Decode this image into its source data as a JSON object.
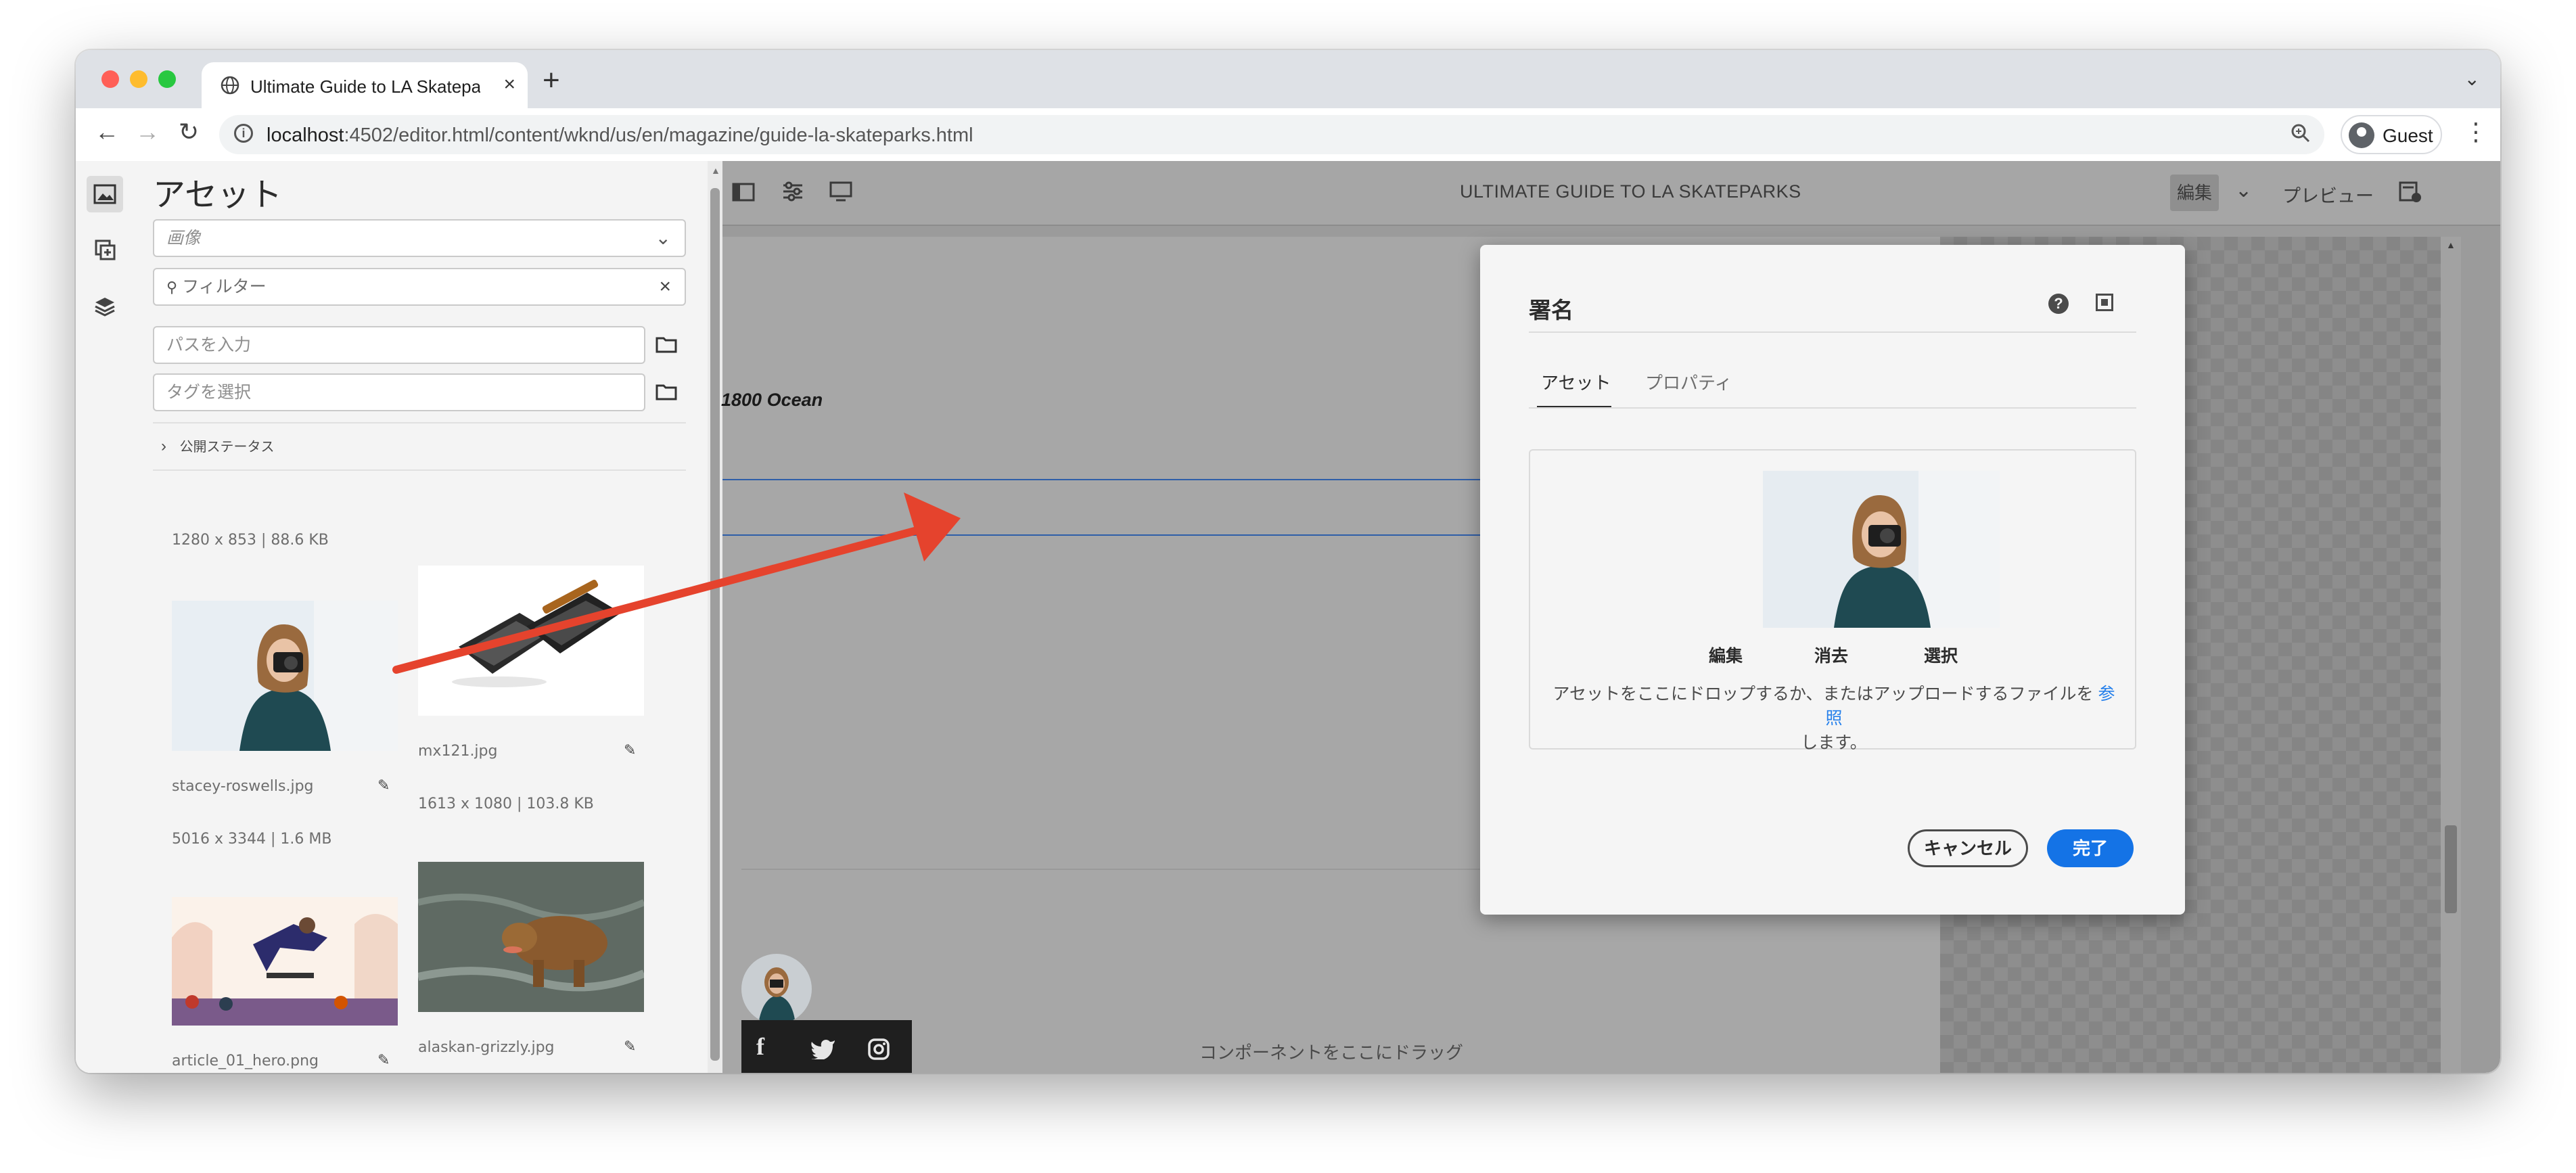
{
  "browser": {
    "tab_title": "Ultimate Guide to LA Skateparks",
    "tab_close": "×",
    "new_tab": "+",
    "url_host": "localhost",
    "url_rest": ":4502/editor.html/content/wknd/us/en/magazine/guide-la-skateparks.html",
    "profile_name": "Guest",
    "back": "←",
    "forward": "→",
    "reload": "↻",
    "menu": "⋮",
    "tab_menu": "⌄"
  },
  "asset_panel": {
    "title": "アセット",
    "type_select": "画像",
    "filter_placeholder": "フィルター",
    "path_placeholder": "パスを入力",
    "tag_placeholder": "タグを選択",
    "publish_status": "公開ステータス",
    "top_meta": "1280 x 853 | 88.6 KB",
    "assets": [
      {
        "name": "stacey-roswells.jpg",
        "meta": "5016 x 3344 | 1.6 MB"
      },
      {
        "name": "mx121.jpg",
        "meta": "1613 x 1080 | 103.8 KB"
      },
      {
        "name": "article_01_hero.png",
        "meta": ""
      },
      {
        "name": "alaskan-grizzly.jpg",
        "meta": ""
      }
    ]
  },
  "editor": {
    "page_title": "ULTIMATE GUIDE TO LA SKATEPARKS",
    "edit_mode": "編集",
    "preview": "プレビュー",
    "page_text": "1800 Ocean",
    "drop_hint": "コンポーネントをここにドラッグ"
  },
  "dialog": {
    "title": "署名",
    "help_icon": "?",
    "tabs": [
      "アセット",
      "プロパティ"
    ],
    "actions": [
      "編集",
      "消去",
      "選択"
    ],
    "drop_text": "アセットをここにドロップするか、またはアップロードするファイルを",
    "drop_link": "参照",
    "drop_text_end": "します。",
    "cancel": "キャンセル",
    "done": "完了"
  },
  "colors": {
    "accent_blue": "#1473e6",
    "arrow_red": "#e5432d",
    "editor_overlay": "#9b9b9b"
  }
}
